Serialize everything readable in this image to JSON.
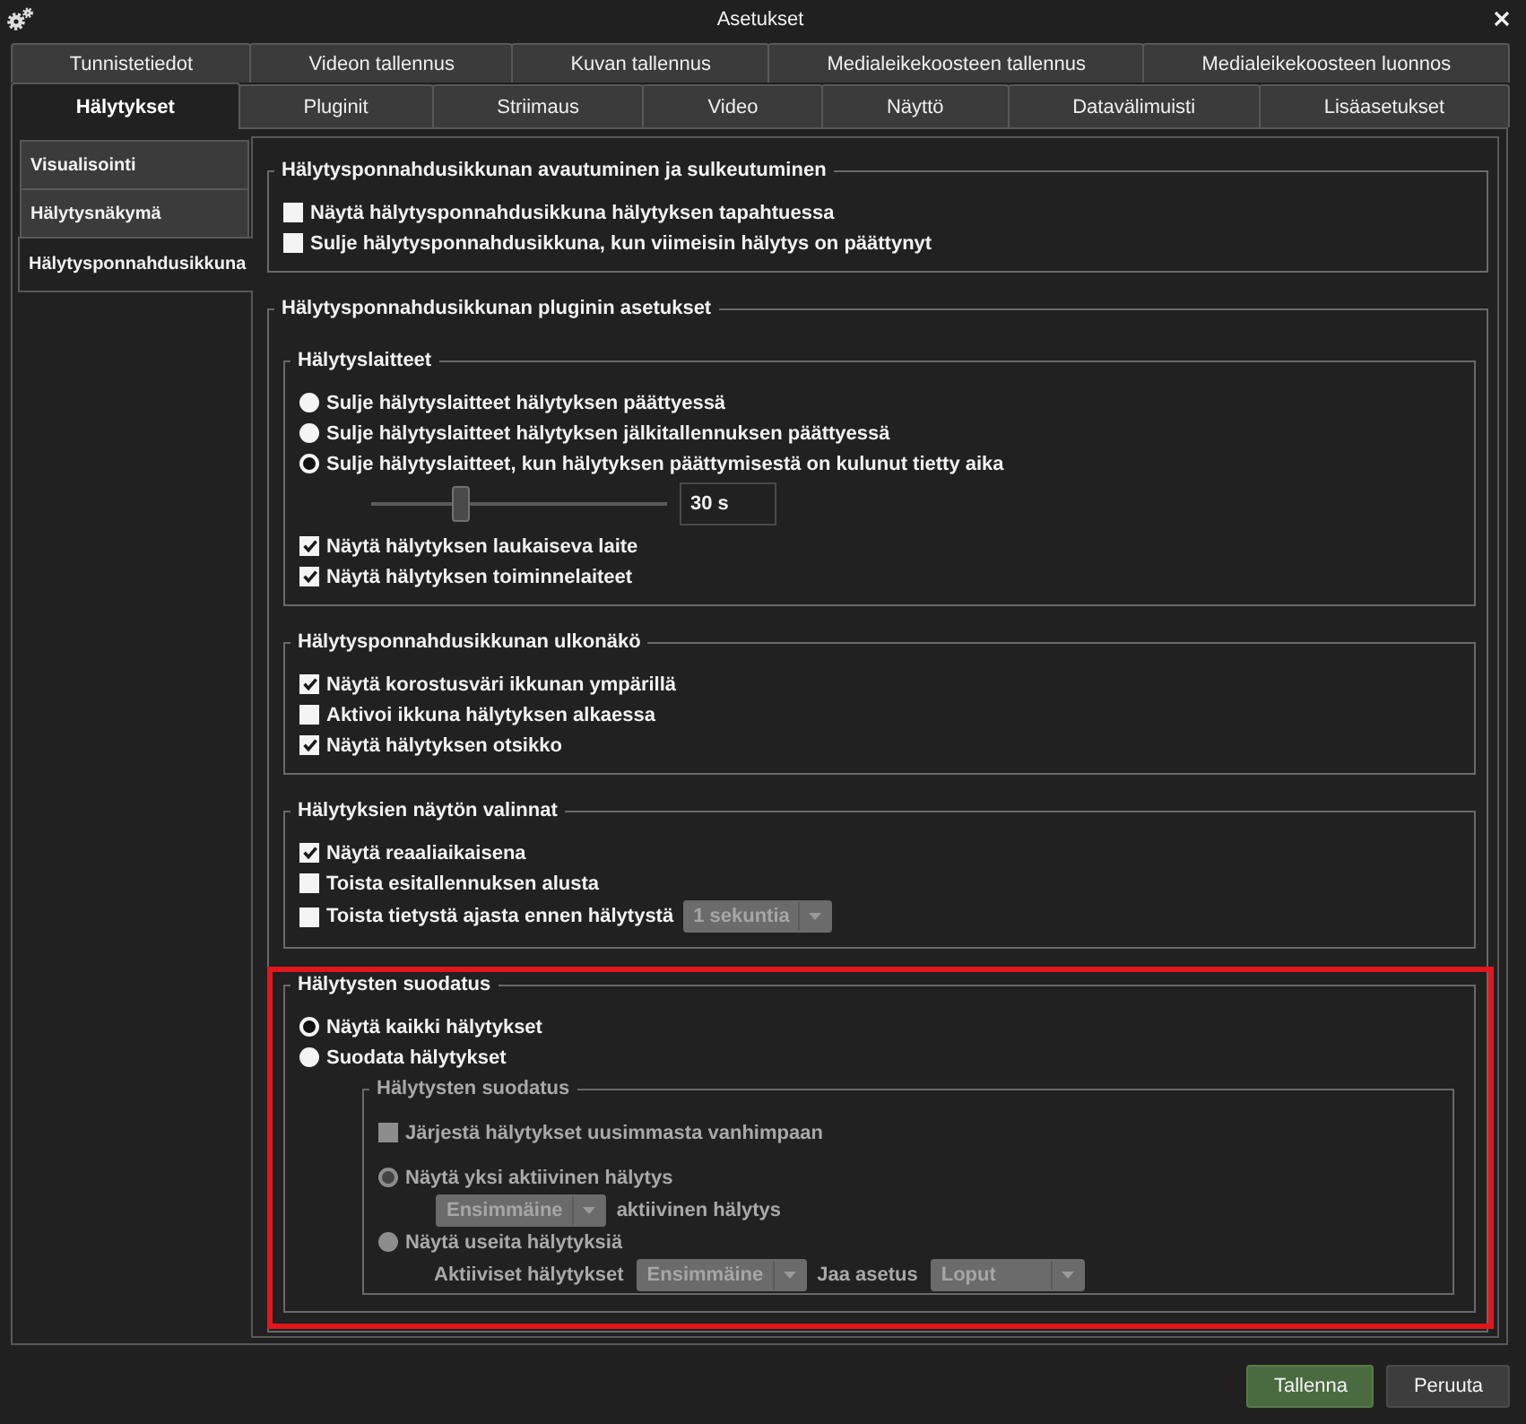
{
  "window": {
    "title": "Asetukset"
  },
  "tab_rows": [
    [
      {
        "label": "Tunnistetiedot",
        "selected": false
      },
      {
        "label": "Videon tallennus",
        "selected": false
      },
      {
        "label": "Kuvan tallennus",
        "selected": false
      },
      {
        "label": "Medialeikekoosteen tallennus",
        "selected": false
      },
      {
        "label": "Medialeikekoosteen luonnos",
        "selected": false
      }
    ],
    [
      {
        "label": "Hälytykset",
        "selected": true
      },
      {
        "label": "Pluginit",
        "selected": false
      },
      {
        "label": "Striimaus",
        "selected": false
      },
      {
        "label": "Video",
        "selected": false
      },
      {
        "label": "Näyttö",
        "selected": false
      },
      {
        "label": "Datavälimuisti",
        "selected": false
      },
      {
        "label": "Lisäasetukset",
        "selected": false
      }
    ]
  ],
  "sidebar": {
    "items": [
      {
        "label": "Visualisointi",
        "selected": false
      },
      {
        "label": "Hälytysnäkymä",
        "selected": false
      },
      {
        "label": "Hälytysponnahdusikkuna",
        "selected": true
      }
    ]
  },
  "groups": [
    {
      "title": "Hälytysponnahdusikkunan avautuminen ja sulkeutuminen",
      "items": [
        {
          "kind": "checkbox",
          "label": "Näytä hälytysponnahdusikkuna hälytyksen tapahtuessa",
          "checked": false
        },
        {
          "kind": "checkbox",
          "label": "Sulje hälytysponnahdusikkuna, kun viimeisin hälytys on päättynyt",
          "checked": false
        }
      ]
    },
    {
      "title": "Hälytysponnahdusikkunan pluginin asetukset",
      "groups": [
        {
          "title": "Hälytyslaitteet",
          "items": [
            {
              "kind": "radio",
              "label": "Sulje hälytyslaitteet hälytyksen päättyessä",
              "selected": false
            },
            {
              "kind": "radio",
              "label": "Sulje hälytyslaitteet hälytyksen jälkitallennuksen päättyessä",
              "selected": false
            },
            {
              "kind": "radio",
              "label": "Sulje hälytyslaitteet, kun hälytyksen päättymisestä on kulunut tietty aika",
              "selected": true
            },
            {
              "kind": "slider",
              "level": 0.3,
              "value": "30 s"
            },
            {
              "kind": "checkbox",
              "label": "Näytä hälytyksen laukaiseva laite",
              "checked": true
            },
            {
              "kind": "checkbox",
              "label": "Näytä hälytyksen toiminnelaiteet",
              "checked": true
            }
          ]
        },
        {
          "title": "Hälytysponnahdusikkunan ulkonäkö",
          "items": [
            {
              "kind": "checkbox",
              "label": "Näytä korostusväri ikkunan ympärillä",
              "checked": true
            },
            {
              "kind": "checkbox",
              "label": "Aktivoi ikkuna hälytyksen alkaessa",
              "checked": false
            },
            {
              "kind": "checkbox",
              "label": "Näytä hälytyksen otsikko",
              "checked": true
            }
          ]
        },
        {
          "title": "Hälytyksien näytön valinnat",
          "items": [
            {
              "kind": "checkbox",
              "label": "Näytä reaaliaikaisena",
              "checked": true
            },
            {
              "kind": "checkbox",
              "label": "Toista esitallennuksen alusta",
              "checked": false
            },
            {
              "kind": "checkbox",
              "label": "Toista tietystä ajasta ennen hälytystä",
              "checked": false,
              "dropdown": {
                "value": "1 sekuntia",
                "disabled": true
              }
            }
          ]
        },
        {
          "title": "Hälytysten suodatus",
          "highlighted": true,
          "items": [
            {
              "kind": "radio",
              "label": "Näytä kaikki hälytykset",
              "selected": true
            },
            {
              "kind": "radio",
              "label": "Suodata hälytykset",
              "selected": false
            },
            {
              "kind": "group",
              "title": "Hälytysten suodatus",
              "disabled": true,
              "items": [
                {
                  "kind": "checkbox",
                  "label": "Järjestä hälytykset uusimmasta vanhimpaan",
                  "checked": false
                },
                {
                  "kind": "radio",
                  "label": "Näytä yksi aktiivinen hälytys",
                  "selected": true
                },
                {
                  "kind": "row",
                  "parts": [
                    {
                      "kind": "dropdown",
                      "value": "Ensimmäine"
                    },
                    {
                      "kind": "text",
                      "text": "aktiivinen hälytys"
                    }
                  ]
                },
                {
                  "kind": "radio",
                  "label": "Näytä useita hälytyksiä",
                  "selected": false
                },
                {
                  "kind": "row",
                  "parts": [
                    {
                      "kind": "text",
                      "text": "Aktiiviset hälytykset"
                    },
                    {
                      "kind": "dropdown",
                      "value": "Ensimmäine"
                    },
                    {
                      "kind": "text",
                      "text": "Jaa asetus"
                    },
                    {
                      "kind": "dropdown",
                      "value": "Loput"
                    }
                  ]
                }
              ]
            }
          ]
        }
      ]
    }
  ],
  "buttons": [
    {
      "label": "Tallenna",
      "primary": true
    },
    {
      "label": "Peruuta",
      "primary": false
    }
  ]
}
